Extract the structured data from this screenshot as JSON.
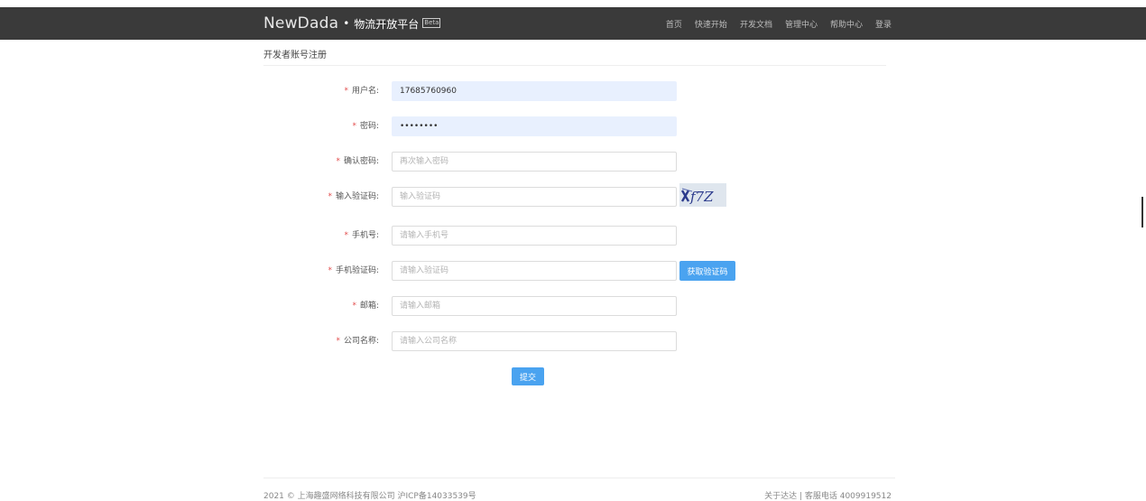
{
  "header": {
    "brand_name": "NewDada",
    "brand_sub": "物流开放平台",
    "brand_badge": "Beta",
    "nav": [
      "首页",
      "快速开始",
      "开发文档",
      "管理中心",
      "帮助中心",
      "登录"
    ]
  },
  "page": {
    "title": "开发者账号注册"
  },
  "form": {
    "username": {
      "label": "用户名:",
      "value": "17685760960"
    },
    "password": {
      "label": "密码:",
      "value": "••••••••"
    },
    "confirm_password": {
      "label": "确认密码:",
      "placeholder": "再次输入密码"
    },
    "captcha": {
      "label": "输入验证码:",
      "placeholder": "输入验证码",
      "image_text": "xf7Z"
    },
    "phone": {
      "label": "手机号:",
      "placeholder": "请输入手机号"
    },
    "sms_code": {
      "label": "手机验证码:",
      "placeholder": "请输入验证码",
      "button": "获取验证码"
    },
    "email": {
      "label": "邮箱:",
      "placeholder": "请输入邮箱"
    },
    "company": {
      "label": "公司名称:",
      "placeholder": "请输入公司名称"
    },
    "submit": "提交"
  },
  "footer": {
    "left": "2021 © 上海趣盛网络科技有限公司 沪ICP备14033539号",
    "right": "关于达达 | 客服电话 4009919512"
  },
  "colors": {
    "accent": "#4aa3f0",
    "required": "#e24c4c",
    "topbar": "#3a3a3a",
    "autofill": "#e8f0fe"
  }
}
